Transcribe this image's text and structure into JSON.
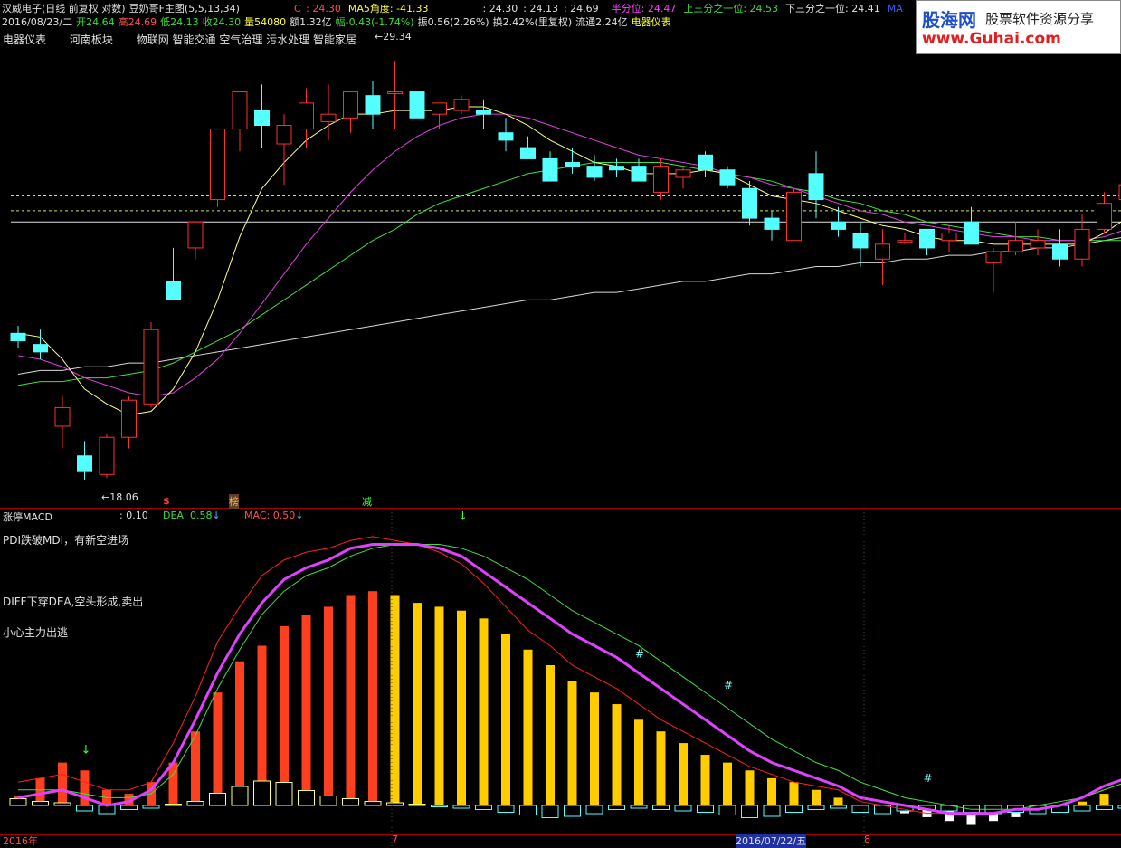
{
  "colors": {
    "up": "#ff3030",
    "down": "#55ffff",
    "ma5": "#ffff80",
    "ma13": "#e040e0",
    "ma34": "#40e040",
    "ma_long": "#d8d8d8"
  },
  "header": {
    "row1": [
      {
        "text": "汉威电子(日线 前复权 对数)",
        "color": "#e0e0e0"
      },
      {
        "text": "豆奶哥F主图(5,5,13,34)",
        "color": "#e0e0e0"
      },
      {
        "text": "C_: 24.30",
        "color": "#ff5050"
      },
      {
        "text": "MA5角度: -41.33",
        "color": "#ffff40"
      },
      {
        "text": ": 24.30",
        "color": "#e0e0e0"
      },
      {
        "text": ": 24.13",
        "color": "#e0e0e0"
      },
      {
        "text": ": 24.69",
        "color": "#e0e0e0"
      },
      {
        "text": "半分位: 24.47",
        "color": "#ff40ff"
      },
      {
        "text": "上三分之一位: 24.53",
        "color": "#3cdc3c"
      },
      {
        "text": "下三分之一位: 24.41",
        "color": "#e0e0e0"
      },
      {
        "text": "MA",
        "color": "#4060ff"
      }
    ],
    "row2": [
      {
        "text": "2016/08/23/二",
        "color": "#e0e0e0"
      },
      {
        "text": "开24.64",
        "color": "#3cdc3c"
      },
      {
        "text": "高24.69",
        "color": "#ff5050"
      },
      {
        "text": "低24.13",
        "color": "#3cdc3c"
      },
      {
        "text": "收24.30",
        "color": "#3cdc3c"
      },
      {
        "text": "量54080",
        "color": "#ffff40"
      },
      {
        "text": "额1.32亿",
        "color": "#e0e0e0"
      },
      {
        "text": "幅-0.43(-1.74%)",
        "color": "#3cdc3c"
      },
      {
        "text": "振0.56(2.26%)",
        "color": "#e0e0e0"
      },
      {
        "text": "换2.42%(里复权)",
        "color": "#e0e0e0"
      },
      {
        "text": "流通2.24亿",
        "color": "#e0e0e0"
      },
      {
        "text": "电器仪表",
        "color": "#ffff40"
      }
    ],
    "row3": [
      "电器仪表",
      "河南板块",
      "物联网 智能交通 空气治理 污水处理 智能家居"
    ]
  },
  "logo": {
    "name": "股海网",
    "slogan": "股票软件资源分享",
    "url": "www.Guhai.com"
  },
  "price_labels": {
    "high": "29.34",
    "low": "18.06"
  },
  "markers": [
    {
      "text": "$",
      "color": "#ff4040"
    },
    {
      "text": "榜",
      "color": "#ffb060"
    },
    {
      "text": "减",
      "color": "#40ff40"
    }
  ],
  "macd": {
    "title": "涨停MACD",
    "value": ": 0.10",
    "dea": "DEA: 0.58",
    "mac": "MAC: 0.50",
    "notes": [
      "PDI跌破MDI，有新空进场",
      "DIFF下穿DEA,空头形成,卖出",
      "小心主力出逃"
    ],
    "hash": "#"
  },
  "axis": {
    "labels": [
      "2016年",
      "7",
      "2016/07/22/五",
      "8"
    ]
  },
  "chart_data": {
    "type": "candlestick",
    "candles": [
      [
        22.0,
        22.2,
        21.6,
        21.8
      ],
      [
        21.7,
        22.1,
        21.3,
        21.5
      ],
      [
        19.5,
        20.3,
        18.9,
        20.0
      ],
      [
        18.7,
        19.1,
        18.06,
        18.3
      ],
      [
        18.2,
        19.3,
        18.1,
        19.2
      ],
      [
        19.2,
        20.3,
        18.9,
        20.2
      ],
      [
        20.1,
        22.3,
        20.0,
        22.1
      ],
      [
        23.4,
        24.3,
        22.9,
        22.9
      ],
      [
        24.3,
        25.0,
        24.0,
        25.0
      ],
      [
        25.6,
        27.2,
        25.4,
        27.5
      ],
      [
        27.5,
        28.5,
        26.9,
        28.5
      ],
      [
        28.0,
        28.7,
        27.0,
        27.6
      ],
      [
        27.1,
        27.9,
        26.0,
        27.6
      ],
      [
        27.5,
        28.6,
        27.0,
        28.2
      ],
      [
        27.7,
        28.7,
        27.2,
        27.9
      ],
      [
        27.8,
        28.5,
        27.4,
        28.5
      ],
      [
        28.4,
        28.8,
        27.5,
        27.9
      ],
      [
        28.5,
        29.34,
        27.5,
        28.5
      ],
      [
        28.5,
        28.5,
        27.8,
        27.8
      ],
      [
        27.9,
        28.2,
        27.5,
        28.2
      ],
      [
        28.0,
        28.4,
        27.9,
        28.3
      ],
      [
        28.0,
        28.3,
        27.5,
        27.9
      ],
      [
        27.4,
        27.8,
        26.9,
        27.2
      ],
      [
        27.0,
        27.3,
        26.8,
        26.7
      ],
      [
        26.7,
        26.9,
        26.1,
        26.1
      ],
      [
        26.6,
        27.0,
        26.3,
        26.5
      ],
      [
        26.5,
        26.8,
        26.1,
        26.2
      ],
      [
        26.5,
        26.7,
        26.2,
        26.4
      ],
      [
        26.5,
        26.7,
        26.1,
        26.1
      ],
      [
        25.8,
        26.7,
        25.6,
        26.5
      ],
      [
        26.2,
        26.5,
        25.9,
        26.4
      ],
      [
        26.8,
        26.9,
        26.2,
        26.4
      ],
      [
        26.4,
        26.5,
        25.9,
        26.0
      ],
      [
        25.9,
        26.1,
        24.9,
        25.1
      ],
      [
        25.1,
        25.3,
        24.5,
        24.8
      ],
      [
        24.5,
        25.9,
        24.6,
        25.8
      ],
      [
        26.3,
        26.9,
        25.1,
        25.6
      ],
      [
        25.0,
        25.4,
        24.6,
        24.8
      ],
      [
        24.7,
        25.0,
        23.8,
        24.3
      ],
      [
        24.0,
        24.8,
        23.3,
        24.4
      ],
      [
        24.5,
        24.7,
        24.4,
        24.5
      ],
      [
        24.8,
        24.8,
        24.1,
        24.3
      ],
      [
        24.5,
        24.9,
        24.2,
        24.7
      ],
      [
        25.0,
        25.4,
        24.4,
        24.4
      ],
      [
        23.9,
        24.3,
        23.1,
        24.2
      ],
      [
        24.2,
        25.0,
        24.1,
        24.5
      ],
      [
        24.3,
        24.8,
        24.1,
        24.5
      ],
      [
        24.4,
        24.8,
        23.8,
        24.0
      ],
      [
        24.0,
        25.2,
        23.8,
        24.8
      ],
      [
        24.8,
        25.8,
        24.7,
        25.5
      ],
      [
        25.6,
        26.0,
        25.3,
        26.0
      ]
    ],
    "ma5": [
      22.0,
      21.9,
      21.3,
      20.5,
      20.1,
      19.8,
      19.9,
      20.5,
      21.5,
      22.9,
      24.6,
      25.9,
      26.6,
      27.2,
      27.6,
      27.9,
      27.9,
      28.0,
      28.0,
      28.0,
      28.1,
      28.1,
      27.9,
      27.6,
      27.2,
      26.9,
      26.6,
      26.5,
      26.3,
      26.3,
      26.3,
      26.4,
      26.3,
      26.0,
      25.7,
      25.6,
      25.5,
      25.3,
      25.1,
      24.9,
      24.8,
      24.6,
      24.5,
      24.5,
      24.4,
      24.4,
      24.4,
      24.4,
      24.4,
      24.7,
      25.1
    ],
    "ma13": [
      21.4,
      21.3,
      21.1,
      20.8,
      20.6,
      20.4,
      20.3,
      20.4,
      20.8,
      21.3,
      22.0,
      22.8,
      23.6,
      24.4,
      25.1,
      25.8,
      26.4,
      26.9,
      27.3,
      27.6,
      27.8,
      27.9,
      27.9,
      27.8,
      27.6,
      27.4,
      27.2,
      27.0,
      26.8,
      26.7,
      26.6,
      26.5,
      26.3,
      26.2,
      26.0,
      25.9,
      25.7,
      25.5,
      25.3,
      25.2,
      25.0,
      24.9,
      24.8,
      24.7,
      24.6,
      24.6,
      24.5,
      24.5,
      24.5,
      24.6,
      24.8
    ],
    "ma34": [
      20.6,
      20.7,
      20.7,
      20.8,
      20.8,
      20.9,
      21.0,
      21.2,
      21.5,
      21.8,
      22.1,
      22.5,
      22.9,
      23.3,
      23.7,
      24.1,
      24.5,
      24.8,
      25.2,
      25.5,
      25.7,
      25.9,
      26.1,
      26.3,
      26.4,
      26.5,
      26.6,
      26.6,
      26.6,
      26.6,
      26.5,
      26.4,
      26.3,
      26.2,
      26.1,
      25.9,
      25.8,
      25.6,
      25.5,
      25.3,
      25.2,
      25.0,
      24.9,
      24.8,
      24.7,
      24.6,
      24.6,
      24.5,
      24.5,
      24.5,
      24.5
    ],
    "ma_long": [
      20.9,
      21.0,
      21.0,
      21.1,
      21.1,
      21.2,
      21.2,
      21.3,
      21.4,
      21.5,
      21.6,
      21.7,
      21.8,
      21.9,
      22.0,
      22.1,
      22.2,
      22.3,
      22.4,
      22.5,
      22.6,
      22.7,
      22.8,
      22.9,
      22.9,
      23.0,
      23.1,
      23.1,
      23.2,
      23.3,
      23.4,
      23.4,
      23.5,
      23.6,
      23.6,
      23.7,
      23.8,
      23.8,
      23.9,
      23.9,
      24.0,
      24.0,
      24.1,
      24.1,
      24.2,
      24.2,
      24.3,
      24.3,
      24.4,
      24.5,
      24.6
    ],
    "hlines": [
      25.7,
      25.3,
      25.0
    ],
    "macd_bars": [
      0.12,
      0.35,
      0.55,
      0.45,
      0.2,
      0.15,
      0.3,
      0.55,
      0.95,
      1.45,
      1.85,
      2.05,
      2.3,
      2.45,
      2.55,
      2.7,
      2.75,
      2.7,
      2.6,
      2.55,
      2.5,
      2.4,
      2.2,
      2.0,
      1.8,
      1.6,
      1.45,
      1.3,
      1.1,
      0.95,
      0.8,
      0.65,
      0.55,
      0.45,
      0.35,
      0.3,
      0.2,
      0.1,
      0.0,
      -0.05,
      -0.1,
      -0.15,
      -0.2,
      -0.25,
      -0.2,
      -0.15,
      -0.1,
      -0.05,
      0.05,
      0.15,
      0.2
    ],
    "macd_small": [
      0.25,
      0.15,
      0.1,
      -0.2,
      -0.3,
      -0.15,
      -0.1,
      0.05,
      0.15,
      0.45,
      0.7,
      0.9,
      0.85,
      0.55,
      0.35,
      0.25,
      0.15,
      0.1,
      0.05,
      -0.05,
      -0.1,
      -0.15,
      -0.25,
      -0.35,
      -0.45,
      -0.4,
      -0.3,
      -0.15,
      -0.1,
      -0.15,
      -0.2,
      -0.25,
      -0.35,
      -0.45,
      -0.4,
      -0.25,
      -0.15,
      -0.1,
      -0.25,
      -0.3,
      -0.2,
      -0.15,
      -0.2,
      -0.25,
      -0.3,
      -0.25,
      -0.3,
      -0.25,
      -0.2,
      -0.15,
      -0.1
    ],
    "diff": [
      0.1,
      0.15,
      0.2,
      0.1,
      0.0,
      0.05,
      0.2,
      0.55,
      1.1,
      1.7,
      2.2,
      2.6,
      2.9,
      3.05,
      3.15,
      3.3,
      3.35,
      3.35,
      3.35,
      3.3,
      3.2,
      3.0,
      2.8,
      2.6,
      2.4,
      2.2,
      2.05,
      1.9,
      1.7,
      1.5,
      1.3,
      1.1,
      0.9,
      0.7,
      0.55,
      0.45,
      0.35,
      0.25,
      0.1,
      0.05,
      0.0,
      -0.05,
      -0.1,
      -0.1,
      -0.1,
      -0.05,
      -0.05,
      0.0,
      0.1,
      0.25,
      0.35
    ],
    "dea": [
      0.2,
      0.2,
      0.2,
      0.15,
      0.1,
      0.1,
      0.15,
      0.4,
      0.9,
      1.5,
      2.0,
      2.45,
      2.75,
      2.95,
      3.05,
      3.2,
      3.3,
      3.35,
      3.35,
      3.35,
      3.3,
      3.2,
      3.05,
      2.9,
      2.7,
      2.5,
      2.35,
      2.2,
      2.05,
      1.85,
      1.65,
      1.45,
      1.25,
      1.05,
      0.85,
      0.7,
      0.55,
      0.45,
      0.3,
      0.2,
      0.1,
      0.05,
      0.0,
      -0.05,
      -0.05,
      -0.05,
      0.0,
      0.05,
      0.1,
      0.2,
      0.3
    ],
    "mac": [
      0.3,
      0.35,
      0.4,
      0.3,
      0.2,
      0.2,
      0.3,
      0.8,
      1.4,
      2.1,
      2.55,
      2.95,
      3.15,
      3.25,
      3.3,
      3.4,
      3.45,
      3.4,
      3.35,
      3.25,
      3.1,
      2.85,
      2.55,
      2.25,
      2.05,
      1.8,
      1.65,
      1.5,
      1.3,
      1.1,
      0.95,
      0.8,
      0.65,
      0.5,
      0.4,
      0.3,
      0.25,
      0.2,
      0.05,
      0.0,
      -0.05,
      -0.1,
      -0.1,
      -0.1,
      -0.1,
      -0.05,
      -0.05,
      0.0,
      0.1,
      0.2,
      0.3
    ]
  }
}
